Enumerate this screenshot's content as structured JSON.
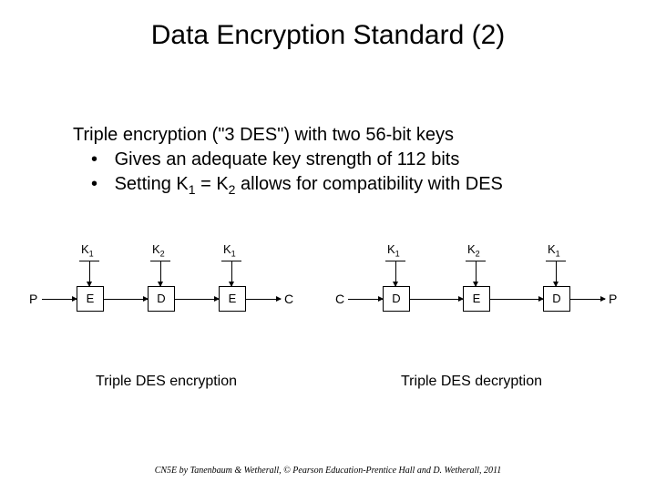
{
  "title": "Data Encryption Standard (2)",
  "body": {
    "line1": "Triple encryption (\"3 DES\") with two 56-bit keys",
    "bullets": [
      "Gives an adequate key strength of 112 bits",
      "Setting K"
    ],
    "sub_a": "1",
    "mid": " = K",
    "sub_b": "2",
    "tail": " allows for compatibility with DES"
  },
  "diagram": {
    "P": "P",
    "C": "C",
    "K1": "K",
    "K1sub": "1",
    "K2": "K",
    "K2sub": "2",
    "E": "E",
    "D": "D",
    "caption_left": "Triple DES encryption",
    "caption_right": "Triple DES decryption"
  },
  "footer": "CN5E by Tanenbaum & Wetherall, © Pearson Education-Prentice Hall and D. Wetherall, 2011"
}
